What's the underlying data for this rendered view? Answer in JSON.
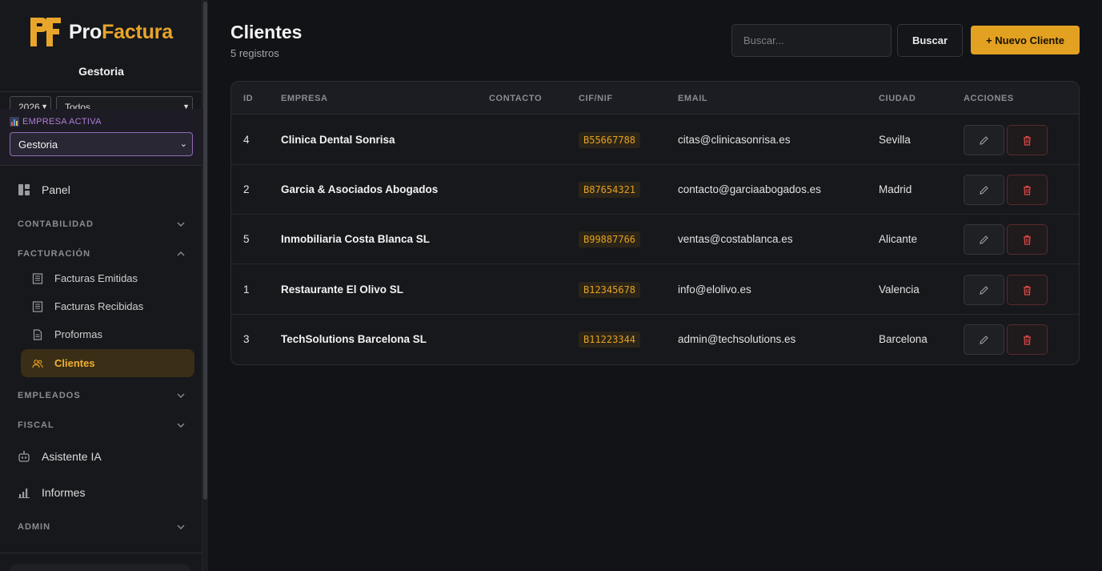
{
  "sidebar": {
    "logo": {
      "pro": "Pro",
      "factura": "Factura",
      "mark": "PF"
    },
    "org_name": "Gestoria",
    "year_select": "2026",
    "period_select": "Todos",
    "empresa_activa": {
      "label": "EMPRESA ACTIVA",
      "value": "Gestoria"
    },
    "panel": "Panel",
    "sections": {
      "contabilidad": "CONTABILIDAD",
      "facturacion": "FACTURACIÓN",
      "empleados": "EMPLEADOS",
      "fiscal": "FISCAL",
      "admin": "ADMIN"
    },
    "facturacion_items": [
      "Facturas Emitidas",
      "Facturas Recibidas",
      "Proformas",
      "Clientes"
    ],
    "asistente": "Asistente IA",
    "informes": "Informes"
  },
  "header": {
    "title": "Clientes",
    "subtitle": "5 registros",
    "search_placeholder": "Buscar...",
    "search_button": "Buscar",
    "new_button": "+ Nuevo Cliente"
  },
  "table": {
    "columns": [
      "ID",
      "EMPRESA",
      "CONTACTO",
      "CIF/NIF",
      "EMAIL",
      "CIUDAD",
      "ACCIONES"
    ],
    "rows": [
      {
        "id": "4",
        "empresa": "Clinica Dental Sonrisa",
        "contacto": "",
        "cif": "B55667788",
        "email": "citas@clinicasonrisa.es",
        "ciudad": "Sevilla"
      },
      {
        "id": "2",
        "empresa": "Garcia & Asociados Abogados",
        "contacto": "",
        "cif": "B87654321",
        "email": "contacto@garciaabogados.es",
        "ciudad": "Madrid"
      },
      {
        "id": "5",
        "empresa": "Inmobiliaria Costa Blanca SL",
        "contacto": "",
        "cif": "B99887766",
        "email": "ventas@costablanca.es",
        "ciudad": "Alicante"
      },
      {
        "id": "1",
        "empresa": "Restaurante El Olivo SL",
        "contacto": "",
        "cif": "B12345678",
        "email": "info@elolivo.es",
        "ciudad": "Valencia"
      },
      {
        "id": "3",
        "empresa": "TechSolutions Barcelona SL",
        "contacto": "",
        "cif": "B11223344",
        "email": "admin@techsolutions.es",
        "ciudad": "Barcelona"
      }
    ]
  },
  "colors": {
    "accent": "#e3a122",
    "background": "#121316",
    "sidebar": "#17181c",
    "danger": "#e04a4a",
    "empresa_purple": "#b07fd8"
  }
}
